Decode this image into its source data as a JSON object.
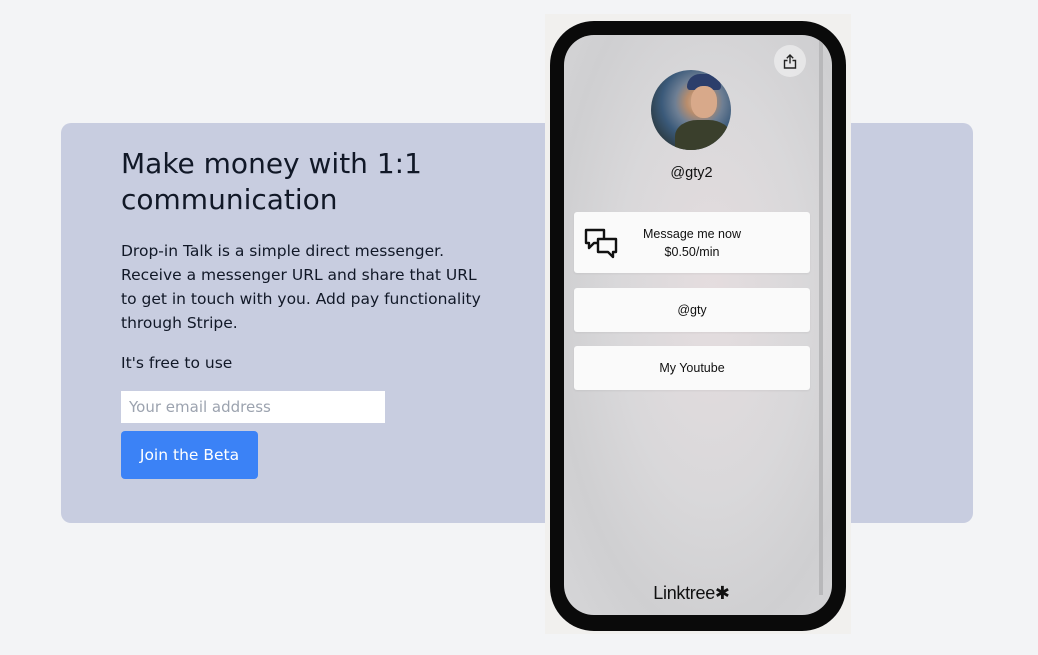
{
  "hero": {
    "title": "Make money with 1:1 communication",
    "description": "Drop-in Talk is a simple direct messenger. Receive a messenger URL and share that URL to get in touch with you. Add pay functionality through Stripe.",
    "free_text": "It's free to use",
    "email_placeholder": "Your email address",
    "email_value": "",
    "join_button": "Join the Beta"
  },
  "phone": {
    "share_icon": "share-icon",
    "handle": "@gty2",
    "links": [
      {
        "line1": "Message me now",
        "line2": "$0.50/min",
        "icon": "chat-icon"
      },
      {
        "label": "@gty"
      },
      {
        "label": "My Youtube"
      }
    ],
    "footer_logo": "Linktree✱"
  },
  "colors": {
    "background": "#f3f4f6",
    "panel": "#c8cde0",
    "accent": "#3b82f6",
    "phone_frame": "#0a0a0a"
  }
}
